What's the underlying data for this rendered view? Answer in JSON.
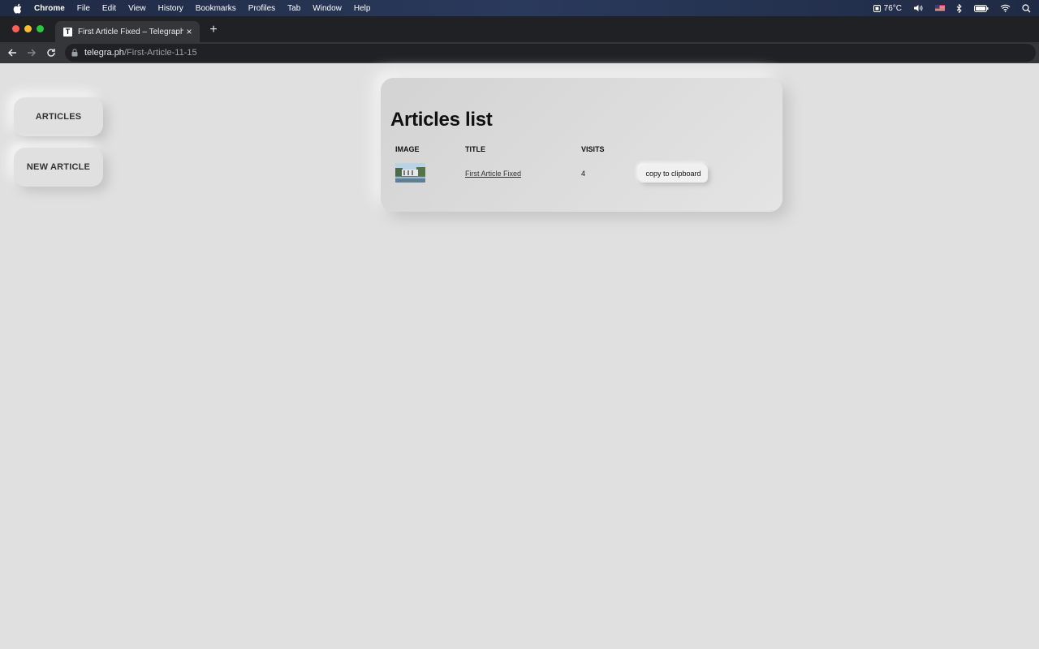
{
  "menubar": {
    "app_name": "Chrome",
    "items": [
      "File",
      "Edit",
      "View",
      "History",
      "Bookmarks",
      "Profiles",
      "Tab",
      "Window",
      "Help"
    ],
    "temperature": "76°C"
  },
  "browser": {
    "tab_title": "First Article Fixed – Telegraph",
    "favicon_letter": "T",
    "tab_close": "×",
    "new_tab": "+",
    "url_domain": "telegra.ph",
    "url_path": "/First-Article-11-15"
  },
  "sidebar": {
    "articles_label": "ARTICLES",
    "new_article_label": "NEW ARTICLE"
  },
  "main": {
    "title": "Articles list",
    "columns": {
      "image": "IMAGE",
      "title": "TITLE",
      "visits": "VISITS"
    },
    "rows": [
      {
        "title": "First Article Fixed",
        "visits": "4",
        "copy_label": "copy to clipboard"
      }
    ]
  },
  "colors": {
    "background": "#e0e0e0",
    "chrome_dark": "#202124",
    "chrome_toolbar": "#35363a"
  }
}
